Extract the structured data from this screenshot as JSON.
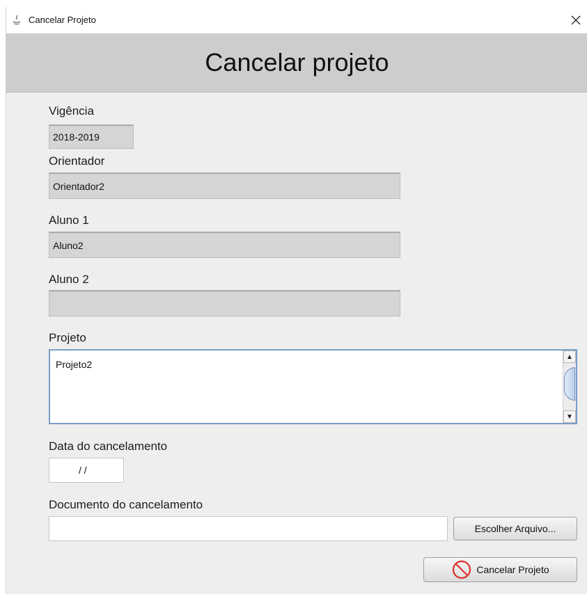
{
  "window": {
    "title": "Cancelar Projeto"
  },
  "header": {
    "title": "Cancelar projeto"
  },
  "form": {
    "vigencia": {
      "label": "Vigência",
      "value": "2018-2019"
    },
    "orientador": {
      "label": "Orientador",
      "value": "Orientador2"
    },
    "aluno1": {
      "label": "Aluno 1",
      "value": "Aluno2"
    },
    "aluno2": {
      "label": "Aluno 2",
      "value": ""
    },
    "projeto": {
      "label": "Projeto",
      "value": "Projeto2"
    },
    "data_cancelamento": {
      "label": "Data do cancelamento",
      "value": "/ /"
    },
    "documento": {
      "label": "Documento do cancelamento",
      "value": "",
      "choose_button": "Escolher Arquivo..."
    }
  },
  "actions": {
    "cancel_button": "Cancelar Projeto",
    "cancel_icon_color": "#e0302a"
  }
}
